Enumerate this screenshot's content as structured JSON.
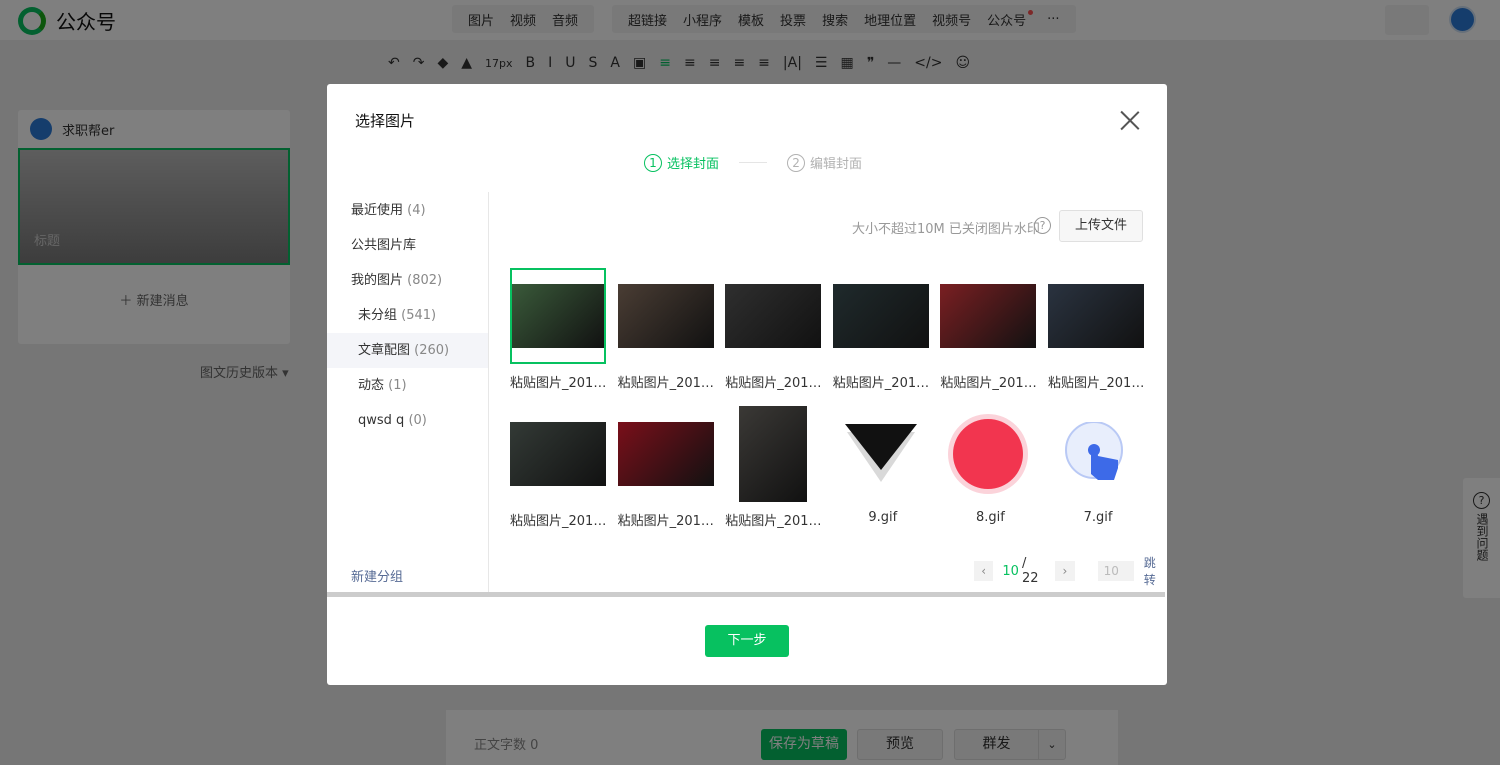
{
  "app": {
    "title": "公众号"
  },
  "topnav": {
    "media_group": [
      "图片",
      "视频",
      "音频"
    ],
    "insert_group": [
      "超链接",
      "小程序",
      "模板",
      "投票",
      "搜索",
      "地理位置",
      "视频号",
      "公众号"
    ],
    "more": "···"
  },
  "toolbar": {
    "font_size": "17px",
    "icons": [
      "undo-icon",
      "redo-icon",
      "format-brush-icon",
      "clear-format-icon",
      "bold-icon",
      "italic-icon",
      "underline-icon",
      "strikethrough-icon",
      "font-color-icon",
      "background-color-icon",
      "align-icon",
      "indent-icon",
      "line-height-icon",
      "letter-spacing-icon",
      "list-icon",
      "table-icon",
      "quote-icon",
      "divider-icon",
      "code-icon",
      "emoji-icon"
    ]
  },
  "account": {
    "name": "求职帮er"
  },
  "article_list": {
    "cover_title_placeholder": "标题",
    "new_message": "新建消息",
    "history": "图文历史版本"
  },
  "bottom_bar": {
    "word_count_label": "正文字数",
    "word_count": "0",
    "save_draft": "保存为草稿",
    "preview": "预览",
    "mass_send": "群发"
  },
  "help_side": {
    "label": "遇到问题"
  },
  "modal": {
    "title": "选择图片",
    "steps": [
      {
        "num": "1",
        "label": "选择封面",
        "active": true
      },
      {
        "num": "2",
        "label": "编辑封面",
        "active": false
      }
    ],
    "sidebar": [
      {
        "label": "最近使用",
        "count": "(4)",
        "sub": false,
        "active": false
      },
      {
        "label": "公共图片库",
        "count": "",
        "sub": false,
        "active": false
      },
      {
        "label": "我的图片",
        "count": "(802)",
        "sub": false,
        "active": false
      },
      {
        "label": "未分组",
        "count": "(541)",
        "sub": true,
        "active": false
      },
      {
        "label": "文章配图",
        "count": "(260)",
        "sub": true,
        "active": true
      },
      {
        "label": "动态",
        "count": "(1)",
        "sub": true,
        "active": false
      },
      {
        "label": "qwsd q",
        "count": "(0)",
        "sub": true,
        "active": false
      }
    ],
    "new_group": "新建分组",
    "upload_hint": "大小不超过10M 已关闭图片水印",
    "upload_button": "上传文件",
    "images": [
      {
        "label": "粘贴图片_2017…",
        "kind": "photo",
        "selected": true,
        "color": "#3a5a3a"
      },
      {
        "label": "粘贴图片_2017…",
        "kind": "photo",
        "selected": false,
        "color": "#4a3d34"
      },
      {
        "label": "粘贴图片_2017…",
        "kind": "photo",
        "selected": false,
        "color": "#2f2f2f"
      },
      {
        "label": "粘贴图片_2017…",
        "kind": "photo",
        "selected": false,
        "color": "#1f2a2c"
      },
      {
        "label": "粘贴图片_2017…",
        "kind": "photo",
        "selected": false,
        "color": "#7a1f22"
      },
      {
        "label": "粘贴图片_2017…",
        "kind": "photo",
        "selected": false,
        "color": "#2a3340"
      },
      {
        "label": "粘贴图片_2017…",
        "kind": "photo",
        "selected": false,
        "color": "#333a36"
      },
      {
        "label": "粘贴图片_2017…",
        "kind": "photo",
        "selected": false,
        "color": "#7a0f1a"
      },
      {
        "label": "粘贴图片_2017…",
        "kind": "portrait",
        "selected": false,
        "color": "#3b3936"
      },
      {
        "label": "9.gif",
        "kind": "triangle",
        "selected": false,
        "color": "#111111"
      },
      {
        "label": "8.gif",
        "kind": "circle",
        "selected": false,
        "color": "#f2354f"
      },
      {
        "label": "7.gif",
        "kind": "tap",
        "selected": false,
        "color": "#3d6ae8"
      }
    ],
    "pager": {
      "current": "10",
      "total": "/ 22",
      "input": "10",
      "jump": "跳转"
    },
    "next_button": "下一步"
  }
}
